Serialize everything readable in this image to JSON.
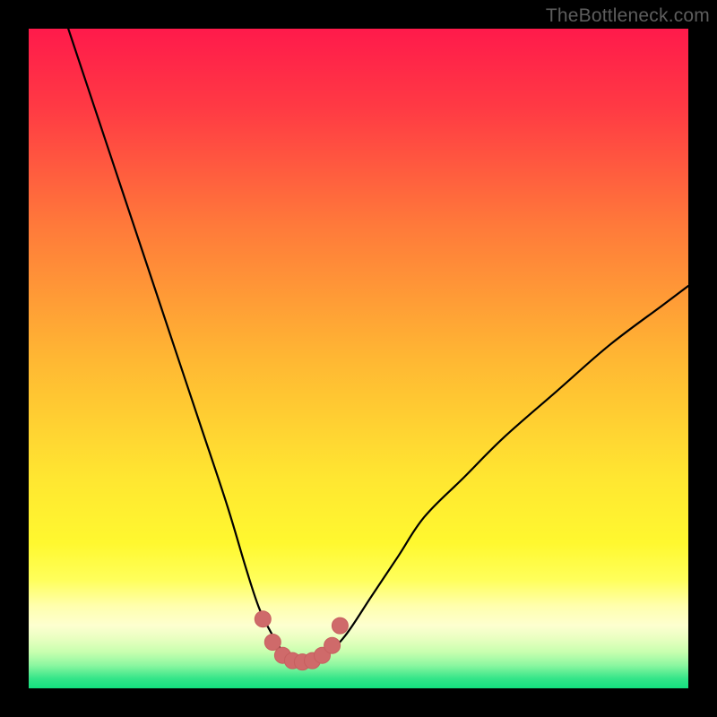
{
  "watermark": {
    "text": "TheBottleneck.com"
  },
  "colors": {
    "black": "#000000",
    "curve": "#000000",
    "marker_fill": "#cf6a6a",
    "marker_stroke": "#c65f5f",
    "gradient_stops": [
      {
        "offset": 0.0,
        "color": "#ff1a4b"
      },
      {
        "offset": 0.12,
        "color": "#ff3a44"
      },
      {
        "offset": 0.3,
        "color": "#ff7a3a"
      },
      {
        "offset": 0.5,
        "color": "#ffb733"
      },
      {
        "offset": 0.68,
        "color": "#ffe631"
      },
      {
        "offset": 0.78,
        "color": "#fff82f"
      },
      {
        "offset": 0.835,
        "color": "#ffff5a"
      },
      {
        "offset": 0.875,
        "color": "#ffffad"
      },
      {
        "offset": 0.905,
        "color": "#fdffd0"
      },
      {
        "offset": 0.925,
        "color": "#e8ffc0"
      },
      {
        "offset": 0.945,
        "color": "#c8ffaf"
      },
      {
        "offset": 0.965,
        "color": "#8cf7a0"
      },
      {
        "offset": 0.985,
        "color": "#35e589"
      },
      {
        "offset": 1.0,
        "color": "#13e07f"
      }
    ]
  },
  "chart_data": {
    "type": "line",
    "title": "",
    "xlabel": "",
    "ylabel": "",
    "xlim": [
      0,
      100
    ],
    "ylim": [
      0,
      100
    ],
    "series": [
      {
        "name": "bottleneck-curve",
        "x": [
          6,
          10,
          14,
          18,
          22,
          26,
          30,
          33,
          35,
          37,
          39,
          41,
          43,
          45,
          48,
          52,
          56,
          60,
          66,
          72,
          80,
          88,
          96,
          100
        ],
        "y": [
          100,
          88,
          76,
          64,
          52,
          40,
          28,
          18,
          12,
          8,
          5,
          4,
          4,
          5,
          8,
          14,
          20,
          26,
          32,
          38,
          45,
          52,
          58,
          61
        ]
      }
    ],
    "markers": {
      "name": "trough-markers",
      "x": [
        35.5,
        37.0,
        38.5,
        40.0,
        41.5,
        43.0,
        44.5,
        46.0,
        47.2
      ],
      "y": [
        10.5,
        7.0,
        5.0,
        4.2,
        4.0,
        4.2,
        5.0,
        6.5,
        9.5
      ]
    }
  }
}
